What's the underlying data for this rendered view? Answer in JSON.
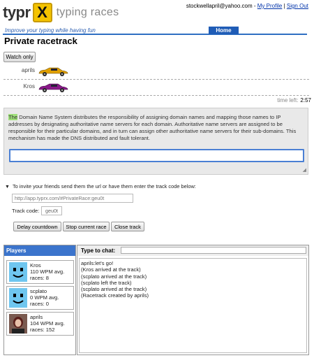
{
  "header": {
    "logo_text": "typr",
    "logo_mark": "X",
    "logo_sub": "typing races",
    "user_email": "stockwellapril@yahoo.com",
    "separator1": " - ",
    "my_profile": "My Profile",
    "separator2": " | ",
    "sign_out": "Sign Out",
    "tagline": "Improve your typing while having fun",
    "home_tab": "Home"
  },
  "page_title": "Private racetrack",
  "watch_only": "Watch only",
  "racers": [
    {
      "name": "aprils",
      "car_color": "#e0a000"
    },
    {
      "name": "Kros",
      "car_color": "#8a1a8a"
    }
  ],
  "time_left": {
    "label": "time left:",
    "value": "2:57"
  },
  "passage": {
    "highlighted": "The",
    "rest": " Domain Name System distributes the responsibility of assigning domain names and mapping those names to IP addresses by designating authoritative name servers for each domain. Authoritative name servers are assigned to be responsible for their particular domains, and in turn can assign other authoritative name servers for their sub-domains. This mechanism has made the DNS distributed and fault tolerant."
  },
  "invite": {
    "text": "To invite your friends send them the url or have them enter the track code below:",
    "url": "http://app.typrx.com/#PrivateRace:geu0t",
    "track_code_label": "Track code:",
    "track_code": "geu0t",
    "delay_button": "Delay countdown",
    "stop_button": "Stop current race",
    "close_button": "Close track"
  },
  "players": {
    "title": "Players",
    "list": [
      {
        "name": "Kros",
        "wpm": "110 WPM avg.",
        "races": "races: 8"
      },
      {
        "name": "scplato",
        "wpm": "0 WPM avg.",
        "races": "races: 0"
      },
      {
        "name": "aprils",
        "wpm": "104 WPM avg.",
        "races": "races: 152"
      }
    ]
  },
  "chat": {
    "label": "Type to chat:",
    "messages": [
      "aprils:let's go!",
      "(Kros arrived at the track)",
      "(scplato arrived at the track)",
      "(scplato left the track)",
      "(scplato arrived at the track)",
      "(Racetrack created by aprils)"
    ]
  }
}
